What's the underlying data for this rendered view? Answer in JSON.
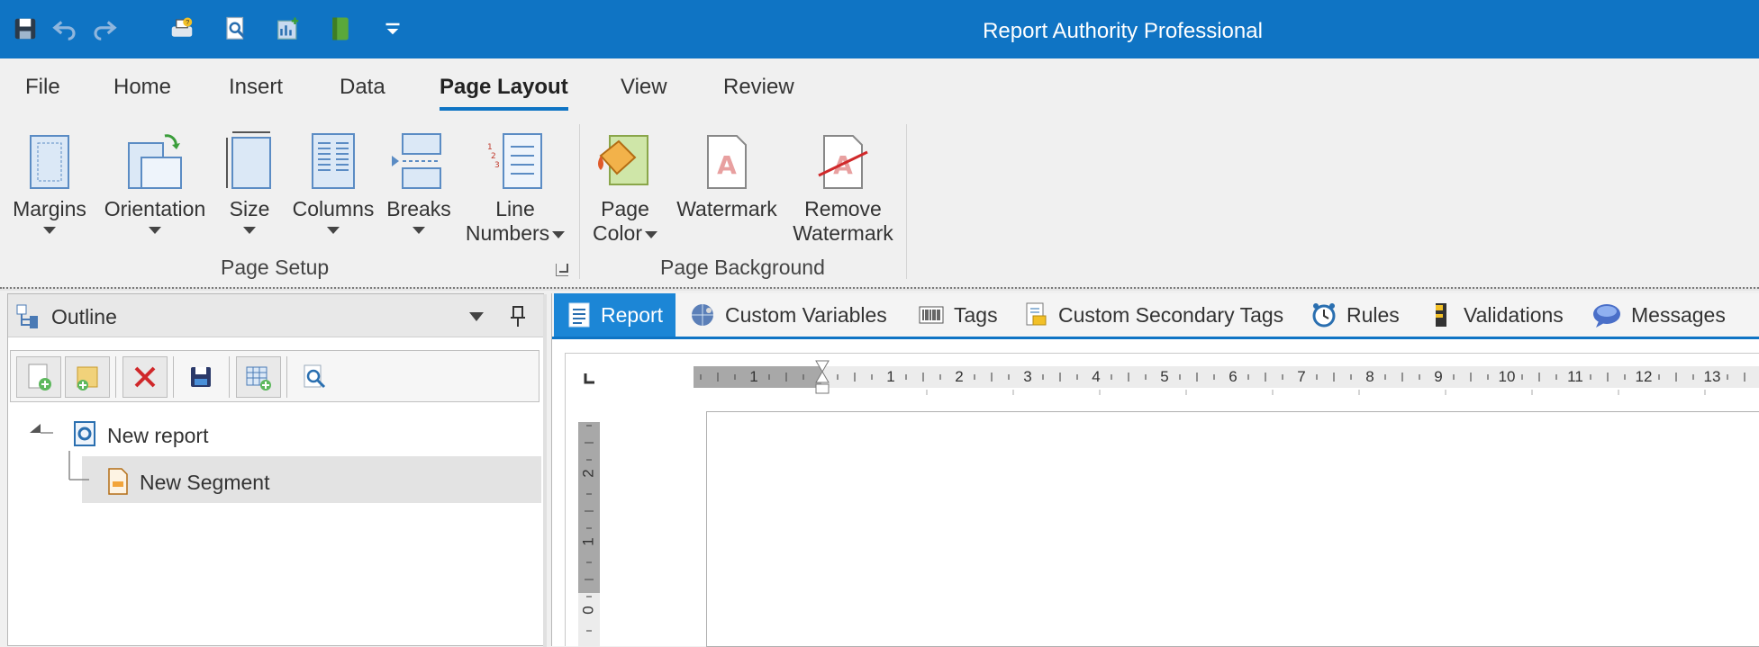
{
  "app": {
    "title": "Report Authority Professional"
  },
  "quick_access": [
    "save-icon",
    "undo-icon",
    "redo-icon",
    "print-icon",
    "preview-icon",
    "report-icon",
    "book-icon",
    "customize-icon"
  ],
  "ribbon_tabs": [
    {
      "label": "File"
    },
    {
      "label": "Home"
    },
    {
      "label": "Insert"
    },
    {
      "label": "Data"
    },
    {
      "label": "Page Layout",
      "active": true
    },
    {
      "label": "View"
    },
    {
      "label": "Review"
    }
  ],
  "ribbon": {
    "page_setup": {
      "label": "Page Setup",
      "margins": "Margins",
      "orientation": "Orientation",
      "size": "Size",
      "columns": "Columns",
      "breaks": "Breaks",
      "line_numbers_1": "Line",
      "line_numbers_2": "Numbers"
    },
    "page_background": {
      "label": "Page Background",
      "page_color_1": "Page",
      "page_color_2": "Color",
      "watermark": "Watermark",
      "remove_watermark_1": "Remove",
      "remove_watermark_2": "Watermark"
    }
  },
  "outline": {
    "title": "Outline",
    "toolbar": [
      "add-report-icon",
      "add-segment-icon",
      "delete-icon",
      "save-icon",
      "add-table-icon",
      "preview-icon"
    ],
    "tree": {
      "root": "New report",
      "child": "New Segment"
    }
  },
  "doc_tabs": [
    {
      "label": "Report",
      "icon": "report-icon",
      "active": true
    },
    {
      "label": "Custom Variables",
      "icon": "globe-icon"
    },
    {
      "label": "Tags",
      "icon": "barcode-icon"
    },
    {
      "label": "Custom Secondary Tags",
      "icon": "document-tag-icon"
    },
    {
      "label": "Rules",
      "icon": "clock-icon"
    },
    {
      "label": "Validations",
      "icon": "validation-icon"
    },
    {
      "label": "Messages",
      "icon": "message-icon"
    }
  ],
  "ruler": {
    "horizontal_labels": [
      "1",
      "1",
      "2",
      "3",
      "4",
      "5",
      "6",
      "7",
      "8",
      "9",
      "10",
      "11",
      "12",
      "13"
    ],
    "vertical_labels": [
      "2",
      "1",
      "0"
    ]
  },
  "colors": {
    "accent": "#0f74c4",
    "tab_active": "#1c86d6"
  }
}
